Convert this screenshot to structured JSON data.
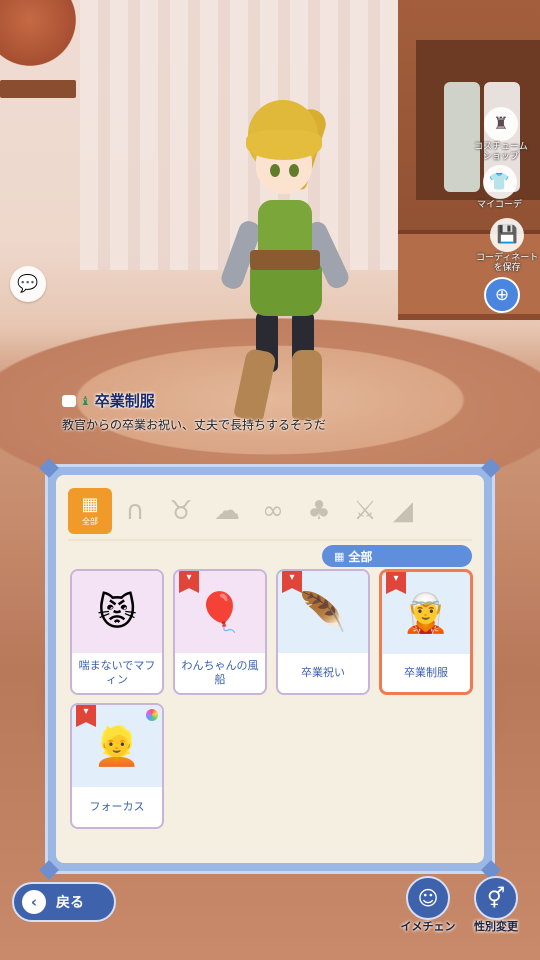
{
  "side_menu": {
    "costume_shop": "コスチューム\nショップ",
    "my_coordinate": "マイコーデ",
    "save_coordinate": "コーディネート\nを保存"
  },
  "item_info": {
    "title": "卒業制服",
    "description": "教官からの卒業お祝い、丈夫で長持ちするそうだ"
  },
  "categories": {
    "all_label": "全部",
    "icons": [
      "cat-ears-icon",
      "fox-mask-icon",
      "hair-icon",
      "eye-mask-icon",
      "outfit-icon",
      "sword-icon",
      "misc-icon"
    ]
  },
  "filter": {
    "label": "全部"
  },
  "items": [
    {
      "name": "喘まないでマフィン",
      "icon": "muffin-cat-icon",
      "bg": "#f3e3f5",
      "tag": false,
      "selected": false
    },
    {
      "name": "わんちゃんの風船",
      "icon": "dog-balloon-icon",
      "bg": "#f3e3f5",
      "tag": true,
      "selected": false
    },
    {
      "name": "卒業祝い",
      "icon": "feather-icon",
      "bg": "#e3eefb",
      "tag": true,
      "selected": false
    },
    {
      "name": "卒業制服",
      "icon": "uniform-icon",
      "bg": "#e3eefb",
      "tag": true,
      "selected": true
    },
    {
      "name": "フォーカス",
      "icon": "hair-focus-icon",
      "bg": "#e3eefb",
      "tag": true,
      "selected": false,
      "palette": true
    }
  ],
  "bottom": {
    "back": "戻る",
    "image_change": "イメチェン",
    "gender_change": "性別変更"
  },
  "colors": {
    "accent_blue": "#3f62ad",
    "category_active": "#f09a2a",
    "selected_border": "#f07a52"
  }
}
